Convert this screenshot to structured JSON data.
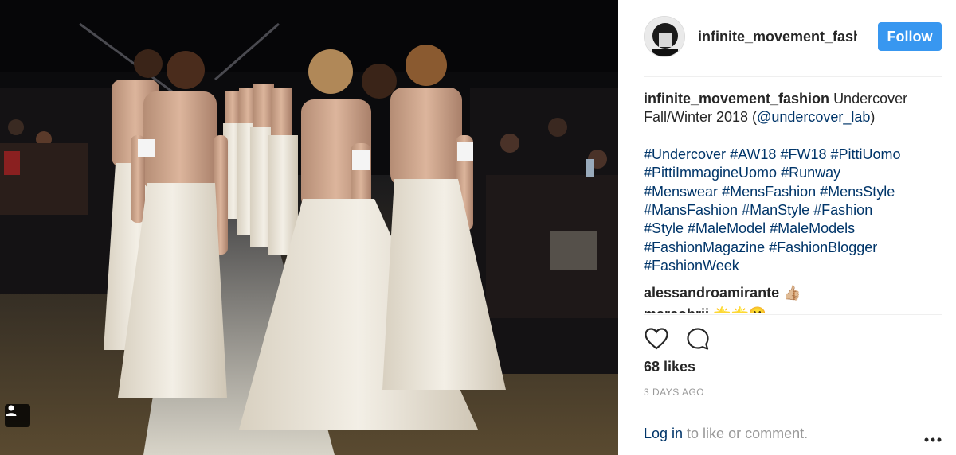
{
  "post": {
    "image_description_icon": "user-tag-icon"
  },
  "header": {
    "username": "infinite_movement_fashion",
    "follow_label": "Follow"
  },
  "caption": {
    "username": "infinite_movement_fashion",
    "text": "Undercover Fall/Winter 2018 (",
    "mention": "@undercover_lab",
    "text_end": ")",
    "hashtags": [
      "#Undercover",
      "#AW18",
      "#FW18",
      "#PittiUomo",
      "#PittiImmagineUomo",
      "#Runway",
      "#Menswear",
      "#MensFashion",
      "#MensStyle",
      "#MansFashion",
      "#ManStyle",
      "#Fashion",
      "#Style",
      "#MaleModel",
      "#MaleModels",
      "#FashionMagazine",
      "#FashionBlogger",
      "#FashionWeek"
    ]
  },
  "comments": [
    {
      "username": "alessandroamirante",
      "text": "👍🏼"
    },
    {
      "username": "marcobrii",
      "text": "🌟🌟😀"
    }
  ],
  "actions": {
    "like_icon": "heart-icon",
    "comment_icon": "comment-icon"
  },
  "likes_text": "68 likes",
  "timestamp": "3 DAYS AGO",
  "login": {
    "link_text": "Log in",
    "rest_text": " to like or comment."
  },
  "colors": {
    "accent": "#3897f0",
    "link": "#003569",
    "muted": "#999999",
    "text": "#262626"
  }
}
